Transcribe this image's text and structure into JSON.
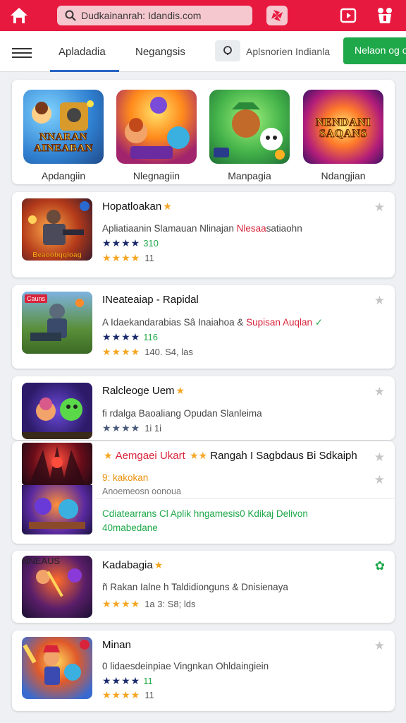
{
  "topbar": {
    "search_text": "Dudkainanrah: Idandis.com",
    "accent": "#e8193f"
  },
  "tabs": {
    "tab1": "Apladadia",
    "tab2": "Negangsis",
    "search_label": "Aplsnorien Indianla",
    "green_button": "Nelaon og ong"
  },
  "featured": [
    {
      "label": "Apdangiin",
      "art": "NNARAN AINEABAN"
    },
    {
      "label": "Nlegnagiin",
      "art": ""
    },
    {
      "label": "Manpagia",
      "art": ""
    },
    {
      "label": "Ndangjian",
      "art": "NENDANI SAQANS"
    }
  ],
  "apps": [
    {
      "title": "Hopatloakan",
      "desc_plain": "Apliatiaanin Slamauan Nlinajan ",
      "desc_red": "Nlesaa",
      "desc_tail": "satiaohn",
      "score": "310",
      "count": "11",
      "badge": "Beaoobqqloag"
    },
    {
      "title": "INeateaiap - Rapidal",
      "desc_plain": "A Idaekandarabias Sâ Inaiahoa & ",
      "desc_red": "Supisan Auqlan",
      "desc_tail": " ✓",
      "score": "116",
      "count": "140. S4, las",
      "badge": "Cauns"
    },
    {
      "title": "Ralcleoge Uem",
      "desc_plain": "fi rdalga Baoaliang Opudan Slanleima",
      "score": "1i 1i"
    },
    {
      "title": "Aemgaei Ukart",
      "title_tail": "Rangah I Sagbdaus Bi Sdkaiph",
      "line2": "9: kakokan",
      "line3": "Anoemeosn oonoua",
      "line4": "Cdiatearrans Cl Aplik hngamesis0 Kdikaj Delivon",
      "line5": "40mabedane"
    },
    {
      "title": "Kadabagia",
      "desc_plain": "ñ Rakan Ialne h Taldidionguns & Dnisienaya",
      "count": "1a 3: S8; lds",
      "art": "NNEAUS"
    },
    {
      "title": "Minan",
      "desc_plain": "0 lidaesdeinpiae Vingnkan Ohldaingiein",
      "score": "11",
      "count": "11"
    }
  ]
}
